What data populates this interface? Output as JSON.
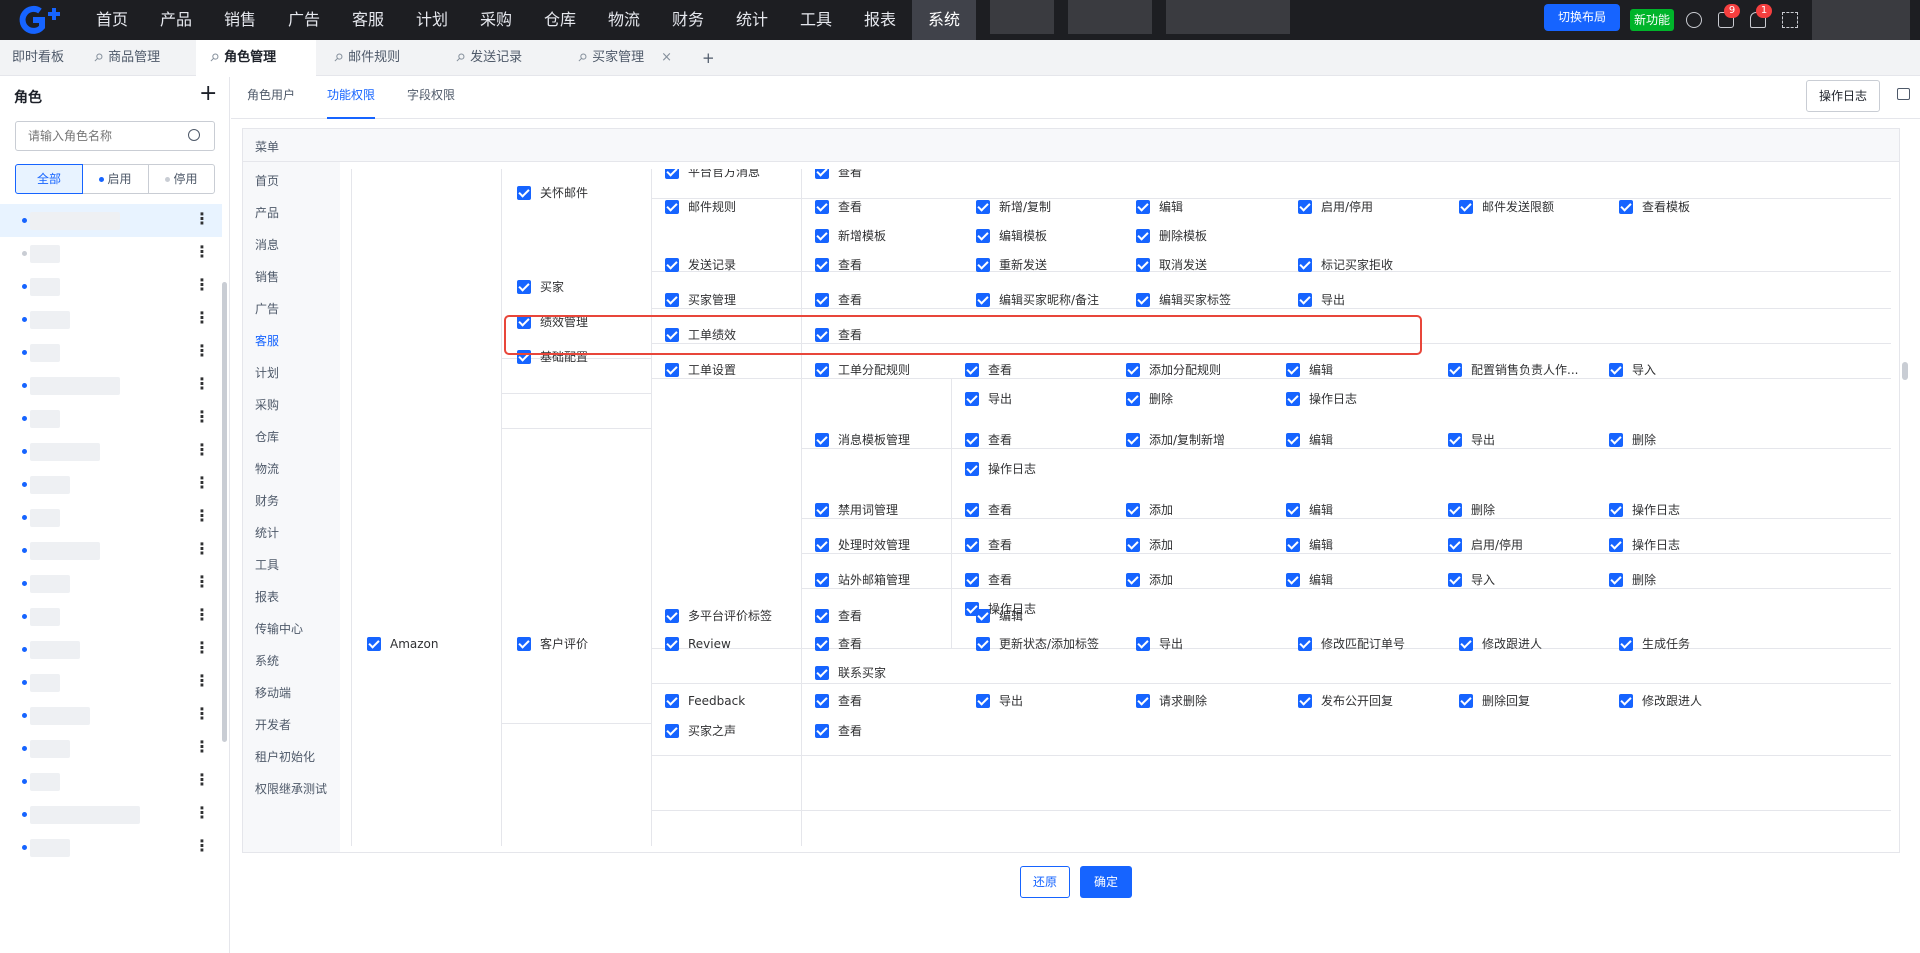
{
  "topnav": {
    "items": [
      "首页",
      "产品",
      "销售",
      "广告",
      "客服",
      "计划",
      "采购",
      "仓库",
      "物流",
      "财务",
      "统计",
      "工具",
      "报表",
      "系统"
    ],
    "active": "系统",
    "switch_layout": "切换布局",
    "new_feature": "新功能",
    "badge_tasks": "9",
    "badge_notice": "1",
    "accent": "#1664ff"
  },
  "tabs": [
    {
      "label": "即时看板"
    },
    {
      "label": "商品管理"
    },
    {
      "label": "角色管理"
    },
    {
      "label": "邮件规则"
    },
    {
      "label": "发送记录"
    },
    {
      "label": "买家管理"
    }
  ],
  "tab_add": "+",
  "tab_close": "×",
  "sidebar": {
    "title": "角色",
    "add": "+",
    "search_placeholder": "请输入角色名称",
    "filters": [
      "全部",
      "启用",
      "停用"
    ]
  },
  "subtabs": [
    "角色用户",
    "功能权限",
    "字段权限"
  ],
  "log_button": "操作日志",
  "menu_header": "菜单",
  "menu": [
    "首页",
    "产品",
    "消息",
    "销售",
    "广告",
    "客服",
    "计划",
    "采购",
    "仓库",
    "物流",
    "财务",
    "统计",
    "工具",
    "报表",
    "传输中心",
    "系统",
    "移动端",
    "开发者",
    "租户初始化",
    "权限继承测试"
  ],
  "menu_active": "客服",
  "permissions": {
    "l2": [
      "关怀邮件",
      "买家",
      "绩效管理",
      "基础配置",
      "客户评价"
    ],
    "amazon": "Amazon",
    "l3": [
      "平台官方消息",
      "邮件规则",
      "发送记录",
      "买家管理",
      "工单绩效",
      "工单设置",
      "多平台评价标签",
      "Review",
      "Feedback",
      "买家之声"
    ],
    "l4": [
      "工单分配规则",
      "消息模板管理",
      "禁用词管理",
      "处理时效管理",
      "站外邮箱管理"
    ],
    "ops": {
      "platform_msg": [
        "查看"
      ],
      "mail_rule": [
        "查看",
        "新增/复制",
        "编辑",
        "启用/停用",
        "邮件发送限额",
        "查看模板",
        "新增模板",
        "编辑模板",
        "删除模板"
      ],
      "send_record": [
        "查看",
        "重新发送",
        "取消发送",
        "标记买家拒收"
      ],
      "buyer_mgmt": [
        "查看",
        "编辑买家昵称/备注",
        "编辑买家标签",
        "导出"
      ],
      "ticket_perf": [
        "查看"
      ],
      "assign_rule": [
        "查看",
        "添加分配规则",
        "编辑",
        "配置销售负责人作...",
        "导入",
        "导出",
        "删除",
        "操作日志"
      ],
      "msg_template": [
        "查看",
        "添加/复制新增",
        "编辑",
        "导出",
        "删除",
        "操作日志"
      ],
      "banned_words": [
        "查看",
        "添加",
        "编辑",
        "删除",
        "操作日志"
      ],
      "timeliness": [
        "查看",
        "添加",
        "编辑",
        "启用/停用",
        "操作日志"
      ],
      "mailbox": [
        "查看",
        "添加",
        "编辑",
        "导入",
        "删除",
        "操作日志"
      ],
      "review_tags": [
        "查看",
        "编辑"
      ],
      "review": [
        "查看",
        "更新状态/添加标签",
        "导出",
        "修改匹配订单号",
        "修改跟进人",
        "生成任务",
        "联系买家"
      ],
      "feedback": [
        "查看",
        "导出",
        "请求删除",
        "发布公开回复",
        "删除回复",
        "修改跟进人"
      ],
      "buyer_voice": [
        "查看"
      ]
    }
  },
  "buttons": {
    "reset": "还原",
    "confirm": "确定"
  }
}
